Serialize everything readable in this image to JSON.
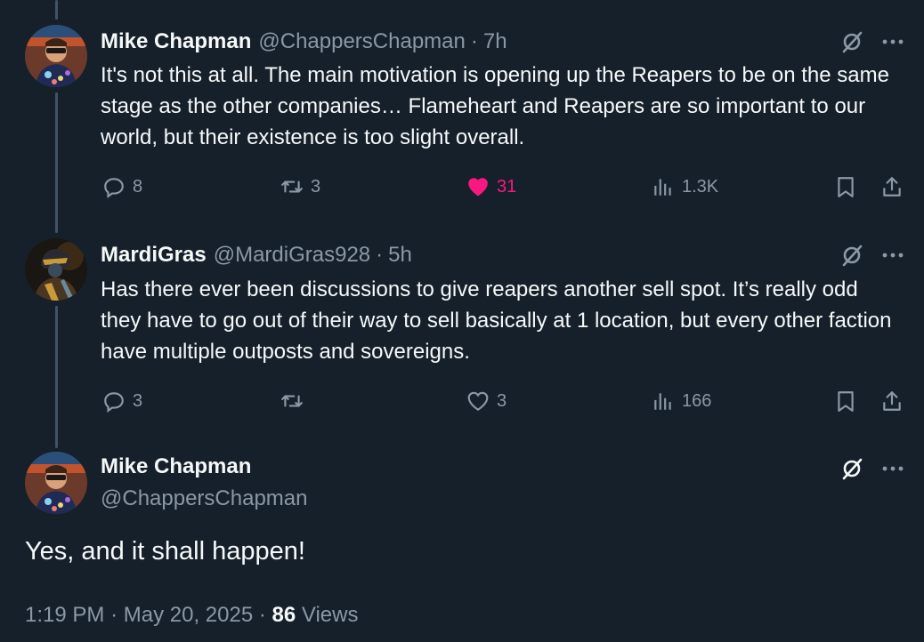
{
  "tweets": [
    {
      "name": "Mike Chapman",
      "handle": "@ChappersChapman",
      "time": "7h",
      "text": "It's not this at all. The main motivation is opening up the Reapers to be on the same stage as the other companies… Flameheart and Reapers are so important to our world, but their existence is too slight overall.",
      "replies": "8",
      "reposts": "3",
      "likes": "31",
      "views": "1.3K",
      "liked": true
    },
    {
      "name": "MardiGras",
      "handle": "@MardiGras928",
      "time": "5h",
      "text": "Has there ever been discussions to give reapers another sell spot. It’s really odd they have to go out of their way to sell basically at 1 location, but every other faction have multiple outposts and sovereigns.",
      "replies": "3",
      "reposts": "",
      "likes": "3",
      "views": "166",
      "liked": false
    }
  ],
  "main": {
    "name": "Mike Chapman",
    "handle": "@ChappersChapman",
    "text": "Yes, and it shall happen!",
    "time": "1:19 PM",
    "date": "May 20, 2025",
    "views_count": "86",
    "views_label": "Views"
  },
  "colors": {
    "background": "#15202b",
    "text": "#f7f9f9",
    "secondary": "#8b98a5",
    "like": "#f91880",
    "thread_line": "#425364"
  },
  "icons": [
    "grok-icon",
    "more-icon",
    "reply-icon",
    "repost-icon",
    "like-icon",
    "views-icon",
    "bookmark-icon",
    "share-icon"
  ]
}
